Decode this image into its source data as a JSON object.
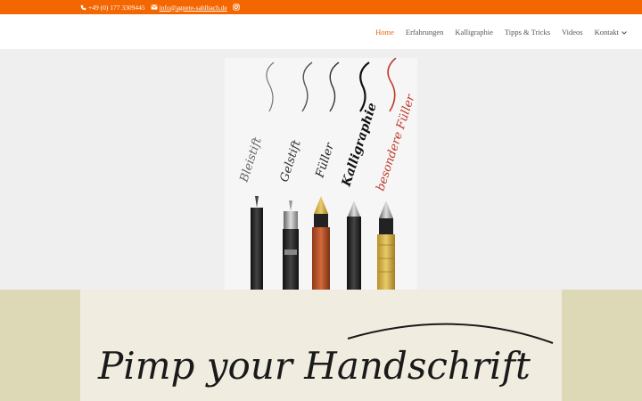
{
  "topbar": {
    "phone": "+49 (0) 177 3309445",
    "email": "info@agnete-sahlbach.de",
    "phone_icon": "phone-icon",
    "email_icon": "envelope-icon",
    "social_icon": "instagram-icon",
    "background": "#f36600"
  },
  "nav": {
    "items": [
      {
        "label": "Home",
        "active": true
      },
      {
        "label": "Erfahrungen"
      },
      {
        "label": "Kalligraphie"
      },
      {
        "label": "Tipps & Tricks"
      },
      {
        "label": "Videos"
      },
      {
        "label": "Kontakt",
        "has_dropdown": true
      }
    ],
    "active_color": "#e8630a"
  },
  "hero": {
    "image": {
      "labels": [
        "Bleistift",
        "Gelstift",
        "Füller",
        "Kalligraphie",
        "besondere Füller"
      ],
      "label_colors": [
        "#444444",
        "#333333",
        "#222222",
        "#111111",
        "#c0392b"
      ]
    }
  },
  "lower": {
    "background": "#ddd8b6",
    "card_text": "Pimp your Handschrift"
  }
}
